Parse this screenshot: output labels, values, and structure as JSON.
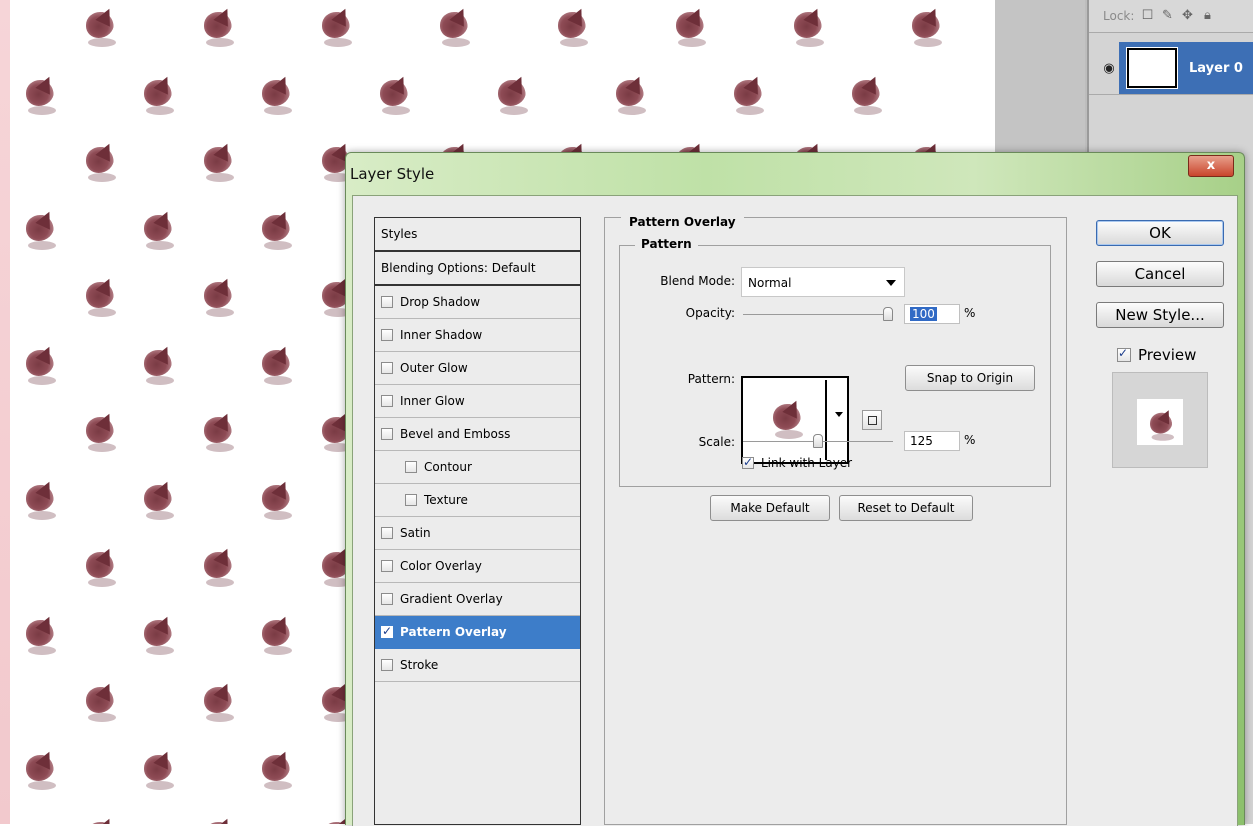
{
  "dialog": {
    "title": "Layer Style",
    "close_label": "x"
  },
  "layers_panel": {
    "lock_label": "Lock:",
    "layer_name": "Layer 0"
  },
  "styles_list": {
    "header": "Styles",
    "blending": "Blending Options: Default",
    "items": [
      {
        "label": "Drop Shadow",
        "checked": false,
        "sub": false,
        "active": false
      },
      {
        "label": "Inner Shadow",
        "checked": false,
        "sub": false,
        "active": false
      },
      {
        "label": "Outer Glow",
        "checked": false,
        "sub": false,
        "active": false
      },
      {
        "label": "Inner Glow",
        "checked": false,
        "sub": false,
        "active": false
      },
      {
        "label": "Bevel and Emboss",
        "checked": false,
        "sub": false,
        "active": false
      },
      {
        "label": "Contour",
        "checked": false,
        "sub": true,
        "active": false
      },
      {
        "label": "Texture",
        "checked": false,
        "sub": true,
        "active": false
      },
      {
        "label": "Satin",
        "checked": false,
        "sub": false,
        "active": false
      },
      {
        "label": "Color Overlay",
        "checked": false,
        "sub": false,
        "active": false
      },
      {
        "label": "Gradient Overlay",
        "checked": false,
        "sub": false,
        "active": false
      },
      {
        "label": "Pattern Overlay",
        "checked": true,
        "sub": false,
        "active": true
      },
      {
        "label": "Stroke",
        "checked": false,
        "sub": false,
        "active": false
      }
    ]
  },
  "pattern_overlay": {
    "section_title": "Pattern Overlay",
    "group_title": "Pattern",
    "blend_mode_label": "Blend Mode:",
    "blend_mode_value": "Normal",
    "opacity_label": "Opacity:",
    "opacity_value": "100",
    "opacity_fraction": 1.0,
    "percent": "%",
    "pattern_label": "Pattern:",
    "snap_to_origin": "Snap to Origin",
    "scale_label": "Scale:",
    "scale_value": "125",
    "scale_fraction": 0.5,
    "link_with_layer": "Link with Layer",
    "link_checked": true,
    "make_default": "Make Default",
    "reset_to_default": "Reset to Default"
  },
  "actions": {
    "ok": "OK",
    "cancel": "Cancel",
    "new_style": "New Style...",
    "preview_label": "Preview",
    "preview_checked": true
  },
  "colors": {
    "selection_blue": "#3d7dc9",
    "layer_selected": "#3d6fb5",
    "motif": "#7a3b44"
  }
}
